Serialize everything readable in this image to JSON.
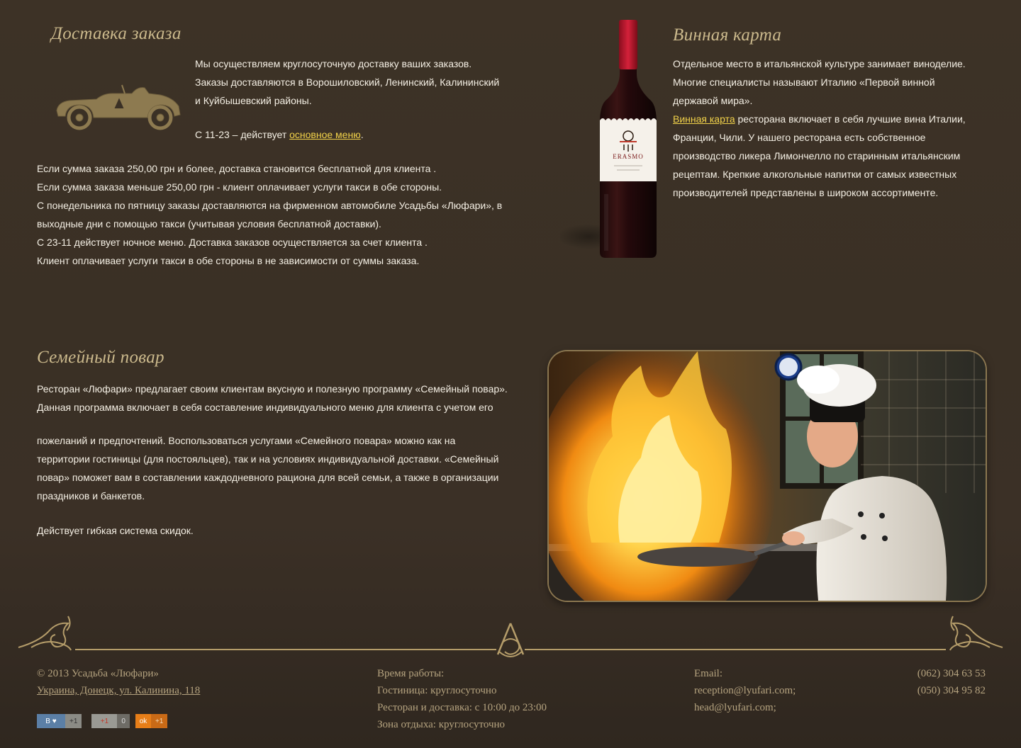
{
  "delivery": {
    "title": "Доставка заказа",
    "intro": [
      "Мы осуществляем круглосуточную доставку ваших заказов.",
      "Заказы доставляются в Ворошиловский, Ленинский, Калининский",
      "и Куйбышевский районы."
    ],
    "hours_prefix": "С 11-23 – действует ",
    "hours_link": "основное меню",
    "hours_suffix": ".",
    "details": [
      "Если сумма заказа 250,00 грн и более, доставка становится бесплатной для клиента .",
      "Если сумма заказа меньше 250,00 грн -  клиент оплачивает  услуги такси в обе стороны.",
      "С понедельника по пятницу заказы доставляются на фирменном автомобиле Усадьбы «Люфари», в",
      "выходные дни с помощью такси (учитывая условия бесплатной доставки).",
      "С 23-11 действует ночное меню. Доставка заказов осуществляется за счет клиента .",
      "Клиент оплачивает услуги такси в обе стороны в не зависимости от суммы заказа."
    ]
  },
  "wine": {
    "title": "Винная карта",
    "intro": [
      "Отдельное место в итальянской культуре занимает виноделие.",
      "Многие специалисты  называют Италию «Первой винной",
      "державой мира»."
    ],
    "link": "Винная карта",
    "after_link": " ресторана включает в себя лучшие вина Италии,",
    "rest": [
      "Франции, Чили. У нашего ресторана есть собственное",
      "производство ликера Лимончелло по старинным итальянским",
      "рецептам. Крепкие алкогольные напитки от самых известных",
      "производителей представлены в широком ассортименте."
    ],
    "bottle_label": "ERASMO"
  },
  "chef": {
    "title": "Семейный повар",
    "para1": [
      "Ресторан «Люфари» предлагает своим клиентам вкусную и полезную программу «Семейный повар».",
      "Данная программа включает в себя составление индивидуального меню для клиента с учетом его"
    ],
    "para2": [
      "пожеланий и предпочтений. Воспользоваться услугами «Семейного повара» можно как на",
      "территории гостиницы (для постояльцев), так и на условиях индивидуальной доставки. «Семейный",
      "повар» поможет вам в составлении каждодневного рациона для всей семьи, а также в организации",
      "праздников и банкетов."
    ],
    "para3": "Действует гибкая система скидок."
  },
  "footer": {
    "copyright": "© 2013 Усадьба «Люфари»",
    "address": "Украина, Донецк, ул. Калинина, 118",
    "hours": [
      "Время работы:",
      "Гостиница: круглосуточно",
      "Ресторан и доставка: с 10:00 до 23:00",
      "Зона отдыха: круглосуточно"
    ],
    "email_label": "Email:",
    "emails": [
      "reception@lyufari.com;",
      "head@lyufari.com;"
    ],
    "phones": [
      "(062) 304 63 53",
      "(050) 304 95 82"
    ]
  },
  "social": {
    "vk_label": "В",
    "vk_count": "+1",
    "gplus_label": "+1",
    "gplus_count": "0",
    "ok_count": "+1"
  },
  "colors": {
    "background": "#3a3025",
    "title": "#cbb98c",
    "link": "#f2d24a",
    "footer_text": "#b5a37f"
  }
}
